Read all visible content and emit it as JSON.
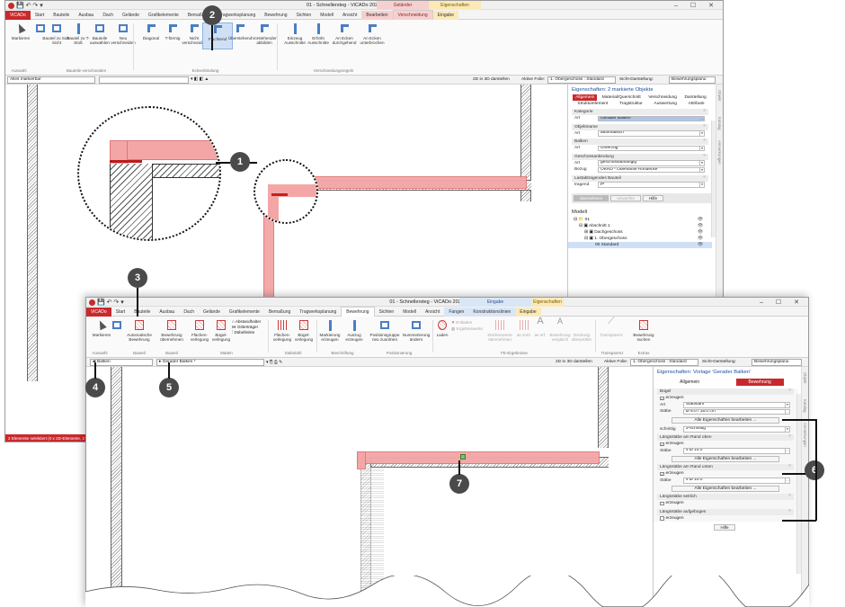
{
  "window1": {
    "title": "01 - Schnellersteg - ViCADo 2020 - [Bewehrung OG]",
    "ctx_a": "Geländer",
    "ctx_b": "Eigenschaften",
    "tabs": [
      "ViCADo",
      "Start",
      "Bauteile",
      "Ausbau",
      "Dach",
      "Gelände",
      "Grafikelemente",
      "Bemaßung",
      "Tragwerksplanung",
      "Bewehrung",
      "Sichten",
      "Modell",
      "Ansicht",
      "Bearbeiten",
      "Verschneidung",
      "Eingabe"
    ],
    "ribbon": {
      "markieren": "Markieren",
      "bauteil_zu": "Bauteil zu Sub-Sicht",
      "bauteil_2": "Bauteil zu T-Stoß",
      "bauteile_ausw": "Bauteile auswählen",
      "neu_verschn": "Neu verschneiden",
      "diagonal": "Diagonal",
      "tfoermig": "T-förmig",
      "nicht_verschn": "Nicht verschneiden",
      "fluchtend": "Fluchtend",
      "ueberstehend": "Überstehend",
      "vorstehender": "Vorstehender abbilden",
      "einzeug": "Einzeug Ausschnitte",
      "erhoeht": "Erhöht Ausschnitte",
      "an_ecken_d": "An Ecken durchgehend",
      "an_ecken_u": "An Ecken unterbrochen",
      "grp_auswahl": "Auswahl",
      "grp_bauteile": "Bauteile verschneiden",
      "grp_eckverb": "Eckverbindung",
      "grp_verschn": "Verschneidungsregeln"
    },
    "toolbar_field": "Alles markierbar",
    "toolbar_right": "2D in 3D darstellen",
    "aktive_folie_label": "Aktive Folie:",
    "aktive_folie": "1. Obergeschoss : Standard",
    "sicht_label": "Sicht-Darstellung:",
    "sicht_val": "Bewehrungsplanu",
    "status": "2 Elemente selektiert (0 x 2D-Elemente, 2 ...",
    "panel": {
      "title": "Eigenschaften: 2 markierte Objekte",
      "tabs": [
        "Allgemein",
        "Material/Querschnitt",
        "Verschneidung",
        "Darstellung",
        "Strukturelement",
        "Tragstruktur",
        "Auswertung",
        "Attribute"
      ],
      "sections": [
        {
          "hdr": "Kategorie",
          "rows": [
            {
              "lb": "Art",
              "val": "Gerader Balken",
              "sel": true
            }
          ]
        },
        {
          "hdr": "Objektname",
          "rows": [
            {
              "lb": "Art",
              "val": "automatisch",
              "dd": true
            }
          ]
        },
        {
          "hdr": "Balken",
          "rows": [
            {
              "lb": "Art",
              "val": "Unterzug",
              "dd": true
            }
          ]
        },
        {
          "hdr": "Geschossanbindung",
          "rows": [
            {
              "lb": "Art",
              "val": "geschossabhängig",
              "dd": true
            },
            {
              "lb": "Bezug",
              "val": "OKRD - Oberkante Rohdecke",
              "dd": true
            }
          ]
        },
        {
          "hdr": "Lastabtragendes Bauteil",
          "rows": [
            {
              "lb": "tragend",
              "val": "ja",
              "dd": true
            }
          ]
        }
      ],
      "btns": [
        "übernehmen",
        "verwerfen",
        "Hilfe"
      ],
      "modell_title": "Modell",
      "tree": [
        "01",
        "Abschnitt 1",
        "Dachgeschoss",
        "1. Obergeschoss",
        "00 Standard"
      ],
      "vtabs": [
        "Objekt",
        "Katalog",
        "Anmerkungen"
      ]
    }
  },
  "window2": {
    "title": "01 - Schnellersteg - ViCADo 2020 - [Bewehrung OG]",
    "ctx_a": "Eingabe",
    "ctx_b": "Eigenschaften",
    "tabs": [
      "ViCADo",
      "Start",
      "Bauteile",
      "Ausbau",
      "Dach",
      "Gelände",
      "Grafikelemente",
      "Bemaßung",
      "Tragwerksplanung",
      "Bewehrung",
      "Sichten",
      "Modell",
      "Ansicht",
      "Fangen",
      "Konstruktionslinien",
      "Eingabe"
    ],
    "ribbon": {
      "markieren": "Markieren",
      "auto_bew": "Automatische Bewehrung",
      "bew_uebern": "Bewehrung übernehmen",
      "flaechen": "Flächen-verlegung",
      "buegel_verl": "Bügel-verlegung",
      "abstandhalter": "Abstandhalter",
      "gittertraeger": "Gitterträger",
      "doebelleiste": "Dübelleiste",
      "flaechen2": "Flächen-verlegung",
      "buegel2": "Bügel-verlegung",
      "markierung": "Markierung erzeugen",
      "auszug": "Auszug erzeugen",
      "positionsgr": "Positionsgruppe neu zuordnen",
      "nummerierung": "Nummerierung ändern",
      "laden": "Laden",
      "entladen": "Entladen",
      "ergebniswerte": "Ergebniswerte",
      "zeichenwerte": "Zeichenwerte übernehmen",
      "as_vorh": "as vorh.",
      "as_erf": "as erf.",
      "bewehrung_vgl": "Bewehrung vergleich",
      "deckung": "Deckung überprüfen",
      "transparenz": "Transparenz",
      "bew_suchen": "Bewehrung suchen",
      "grp_auswahl": "Auswahl",
      "grp_bauteil": "Bauteil",
      "grp_bauteil2": "Bauteil",
      "grp_matten": "Matten",
      "grp_stabstahl": "Stabstahl",
      "grp_beschr": "Beschriftung",
      "grp_pos": "Positionierung",
      "grp_fe": "FE-Ergebnisse",
      "grp_transp": "Transparenz",
      "grp_extras": "Extras"
    },
    "toolbar_field1": "Balken",
    "toolbar_field2": "Gerader Balken *",
    "toolbar_right": "2D in 3D darstellen",
    "aktive_folie_label": "Aktive Folie:",
    "aktive_folie": "1. Obergeschoss : Standard",
    "sicht_label": "Sicht-Darstellung:",
    "sicht_val": "Bewehrungsplanu",
    "panel": {
      "title": "Eigenschaften: Vorlage 'Gerader Balken'",
      "tab_allgemein": "Allgemein",
      "tab_bewehrung": "Bewehrung",
      "buegel_hdr": "Bügel",
      "erzeugen": "erzeugen",
      "art_lb": "Art",
      "art_val": "Stabstahl",
      "staebe_lb": "Stäbe",
      "buegel_staebe": "Ø 8.0 / 15.0 cm",
      "alle_eig": "Alle Eigenschaften bearbeiten ...",
      "schnittig_lb": "schnittig",
      "schnittig_val": "2-schnittig",
      "oben_hdr": "Längsstäbe am Rand oben",
      "oben_staebe": "4 Ø 14.0",
      "unten_hdr": "Längsstäbe am Rand unten",
      "unten_staebe": "4 Ø 10.0",
      "seitlich_hdr": "Längsstäbe seitlich",
      "aufgebogen_hdr": "Längsstäbe aufgebogen",
      "hilfe": "Hilfe",
      "vtabs": [
        "Objekt",
        "Katalog",
        "Anmerkungen"
      ]
    }
  },
  "callouts": [
    "1",
    "2",
    "3",
    "4",
    "5",
    "6",
    "7"
  ],
  "colors": {
    "accent": "#c9292d",
    "beam": "#f4a6a6",
    "callout": "#4a4a4a",
    "link": "#1a4fa0"
  }
}
